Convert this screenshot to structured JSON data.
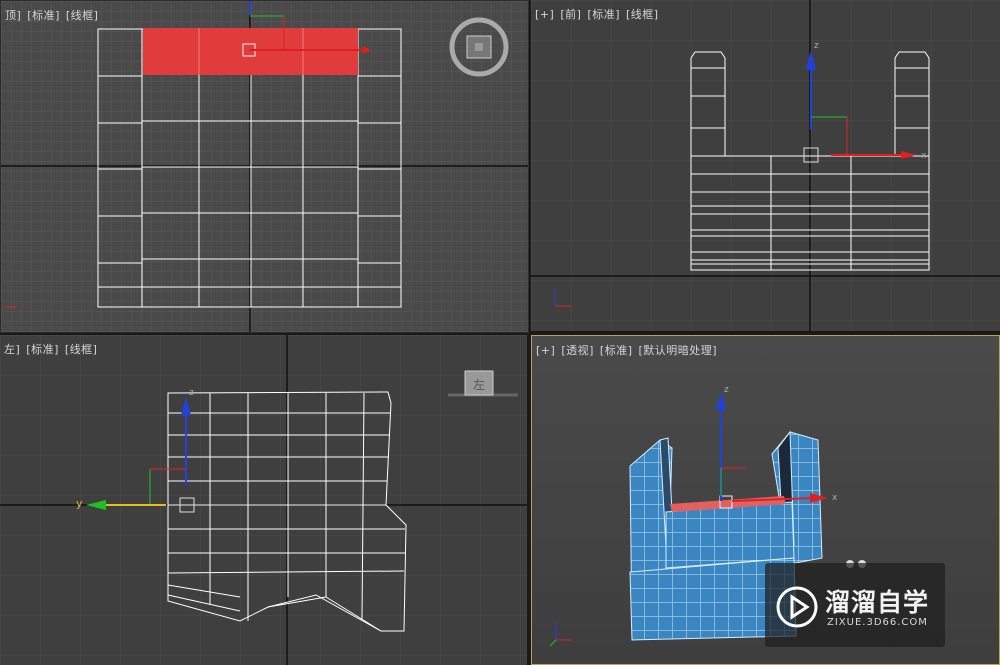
{
  "viewports": {
    "top": {
      "labels": [
        "顶]",
        "[标准]",
        "[线框]"
      ],
      "axis_x": "x"
    },
    "front": {
      "labels": [
        "[+]",
        "[前]",
        "[标准]",
        "[线框]"
      ],
      "axis_z": "z",
      "axis_x": "x"
    },
    "left": {
      "labels": [
        "左]",
        "[标准]",
        "[线框]"
      ],
      "gizmo_y": "y",
      "axis_z": "z",
      "axis_y": "y",
      "viewcube_label": "左"
    },
    "perspective": {
      "labels": [
        "[+]",
        "[透视]",
        "[标准]",
        "[默认明暗处理]"
      ],
      "axis_z": "z",
      "axis_x": "x",
      "axis_y": "y"
    }
  },
  "watermark": {
    "title": "溜溜自学",
    "subtitle": "ZIXUE.3D66.COM"
  },
  "colors": {
    "selection_red": "#e04040",
    "wire_white": "#ffffff",
    "model_blue": "#3a86c0",
    "axis_x": "#e02020",
    "axis_y": "#20c020",
    "axis_z": "#2040e0"
  }
}
